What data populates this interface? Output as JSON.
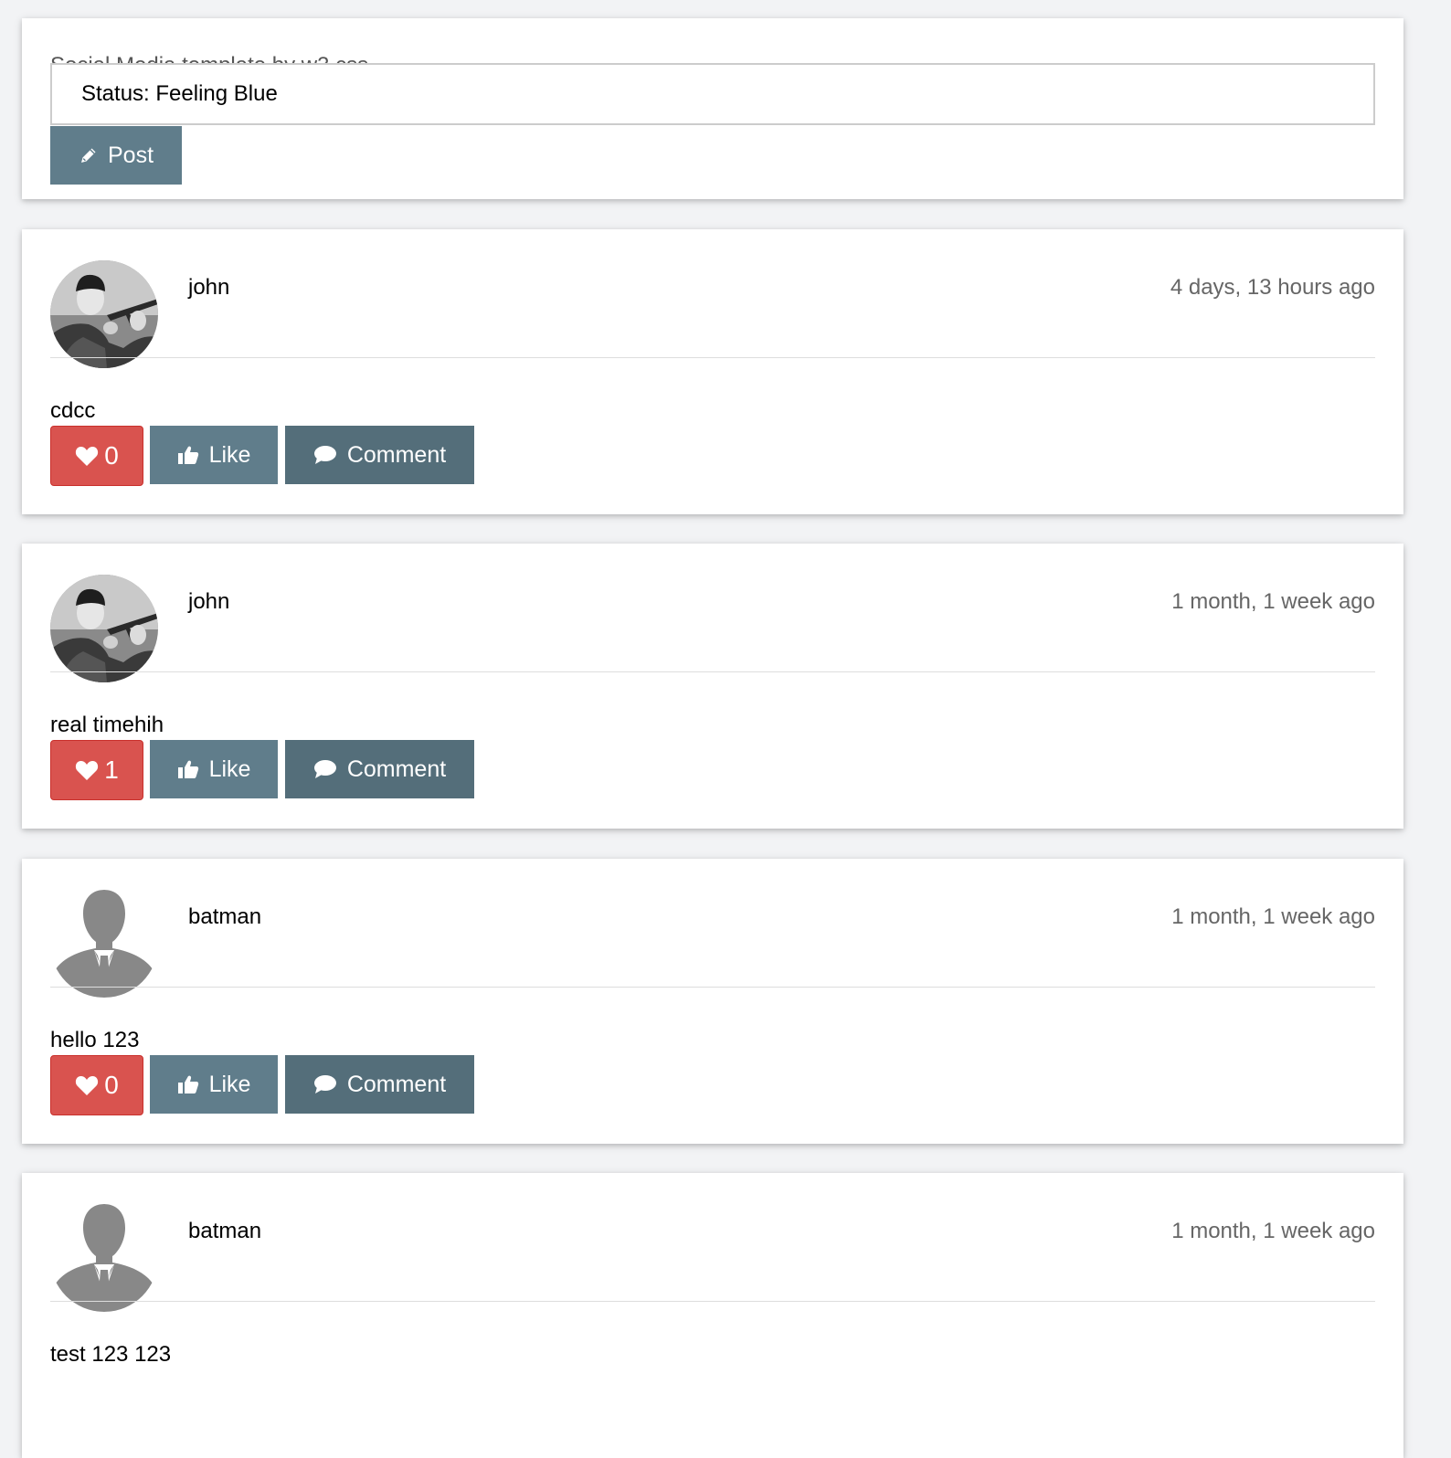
{
  "composer": {
    "label": "Social Media template by w3.css",
    "status_value": "Status: Feeling Blue",
    "post_label": "Post",
    "post_icon": "pencil-icon"
  },
  "buttons": {
    "like_label": "Like",
    "comment_label": "Comment",
    "heart_icon": "heart-icon",
    "like_icon": "thumbs-up-icon",
    "comment_icon": "comment-icon"
  },
  "colors": {
    "post_button": "#607d8b",
    "like_button": "#607d8b",
    "comment_button": "#546e7a",
    "heart_button": "#d9534f"
  },
  "posts": [
    {
      "user": "john",
      "avatar": "photo",
      "time": "4 days, 13 hours ago",
      "text": "cdcc",
      "hearts": "0"
    },
    {
      "user": "john",
      "avatar": "photo",
      "time": "1 month, 1 week ago",
      "text": "real timehih",
      "hearts": "1"
    },
    {
      "user": "batman",
      "avatar": "silhouette",
      "time": "1 month, 1 week ago",
      "text": "hello 123",
      "hearts": "0"
    },
    {
      "user": "batman",
      "avatar": "silhouette",
      "time": "1 month, 1 week ago",
      "text": "test 123 123",
      "hearts": ""
    }
  ]
}
